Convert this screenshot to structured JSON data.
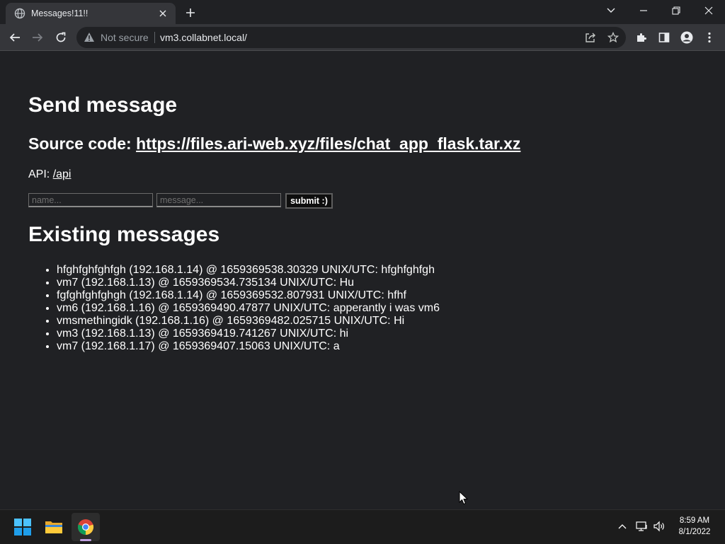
{
  "browser": {
    "tab_title": "Messages!11!!",
    "not_secure": "Not secure",
    "url": "vm3.collabnet.local/"
  },
  "page": {
    "heading_send": "Send message",
    "source_label": "Source code: ",
    "source_url": "https://files.ari-web.xyz/files/chat_app_flask.tar.xz",
    "api_label": "API: ",
    "api_link": "/api",
    "name_placeholder": "name...",
    "message_placeholder": "message...",
    "submit_label": "submit :)",
    "heading_existing": "Existing messages",
    "messages": [
      "hfghfghfghfgh (192.168.1.14) @ 1659369538.30329 UNIX/UTC: hfghfghfgh",
      "vm7 (192.168.1.13) @ 1659369534.735134 UNIX/UTC: Hu",
      "fgfghfghfghgh (192.168.1.14) @ 1659369532.807931 UNIX/UTC: hfhf",
      "vm6 (192.168.1.16) @ 1659369490.47877 UNIX/UTC: apperantly i was vm6",
      "vmsmethingidk (192.168.1.16) @ 1659369482.025715 UNIX/UTC: Hi",
      "vm3 (192.168.1.13) @ 1659369419.741267 UNIX/UTC: hi",
      "vm7 (192.168.1.17) @ 1659369407.15063 UNIX/UTC: a"
    ]
  },
  "taskbar": {
    "time": "8:59 AM",
    "date": "8/1/2022"
  }
}
